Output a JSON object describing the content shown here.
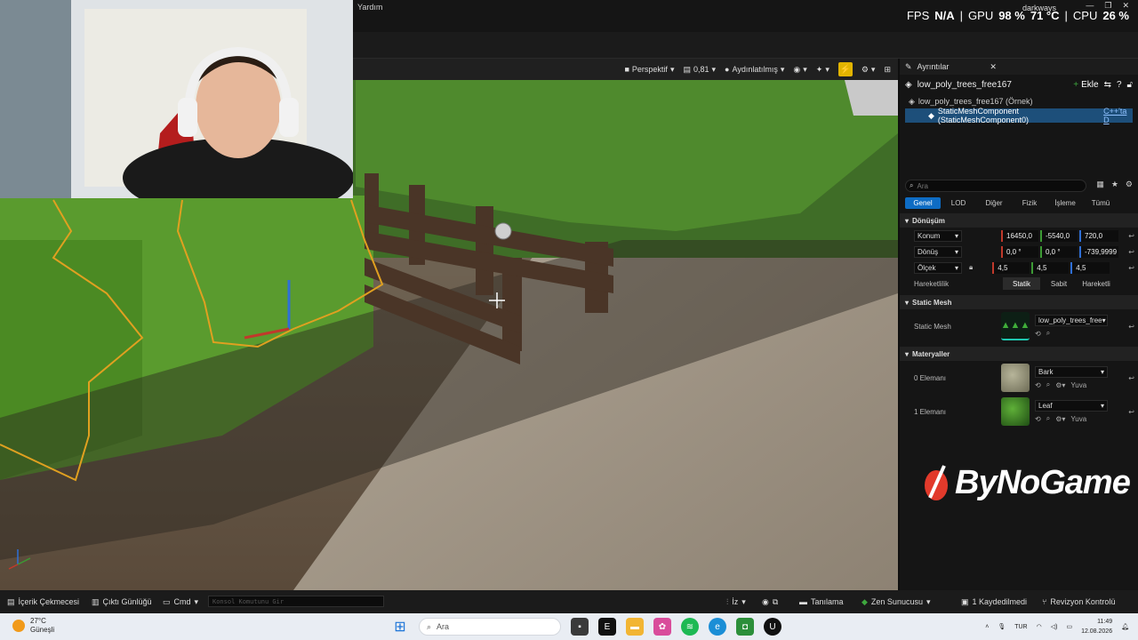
{
  "top": {
    "menu_help": "Yardım",
    "user": "darkways",
    "fps_label": "FPS",
    "fps_value": "N/A",
    "gpu_label": "GPU",
    "gpu_usage": "98 %",
    "gpu_temp": "71 °C",
    "cpu_label": "CPU",
    "cpu_usage": "26 %"
  },
  "viewport_toolbar": {
    "perspective": "Perspektif",
    "camera_speed": "0,81",
    "lit_mode": "Aydınlatılmış"
  },
  "details": {
    "tab": "Ayrıntılar",
    "object_name": "low_poly_trees_free167",
    "add": "Ekle",
    "tree_root": "low_poly_trees_free167 (Örnek)",
    "tree_child": "StaticMeshComponent (StaticMeshComponent0)",
    "tree_child_link": "C++'ta D",
    "search_placeholder": "Ara",
    "filters": [
      "Genel",
      "LOD",
      "Diğer",
      "Fizik",
      "İşleme",
      "Tümü"
    ],
    "transform": {
      "section": "Dönüşüm",
      "location_label": "Konum",
      "location": [
        "16450,0",
        "-5540,0",
        "720,0"
      ],
      "rotation_label": "Dönüş",
      "rotation": [
        "0,0 °",
        "0,0 °",
        "-739,9999"
      ],
      "scale_label": "Ölçek",
      "scale": [
        "4,5",
        "4,5",
        "4,5"
      ],
      "mobility_label": "Hareketlilik",
      "mobility": [
        "Statik",
        "Sabit",
        "Hareketli"
      ]
    },
    "static_mesh": {
      "section": "Static Mesh",
      "label": "Static Mesh",
      "value": "low_poly_trees_free"
    },
    "materials": {
      "section": "Materyaller",
      "items": [
        {
          "label": "0 Elemanı",
          "value": "Bark",
          "extra": "Yuva"
        },
        {
          "label": "1 Elemanı",
          "value": "Leaf",
          "extra": "Yuva"
        }
      ]
    }
  },
  "brand": "ByNoGame",
  "bottom": {
    "content_drawer": "İçerik Çekmecesi",
    "output_log": "Çıktı Günlüğü",
    "cmd": "Cmd",
    "console_placeholder": "Konsol Komutunu Gir",
    "trace": "İz",
    "derive": "Tanılama",
    "zen": "Zen Sunucusu",
    "saved": "1 Kaydedilmedi",
    "revision": "Revizyon Kontrolü"
  },
  "taskbar": {
    "temp": "27°C",
    "weather": "Güneşli",
    "search": "Ara",
    "lang": "TUR",
    "time": "11:49",
    "date": "12.08.2026"
  }
}
